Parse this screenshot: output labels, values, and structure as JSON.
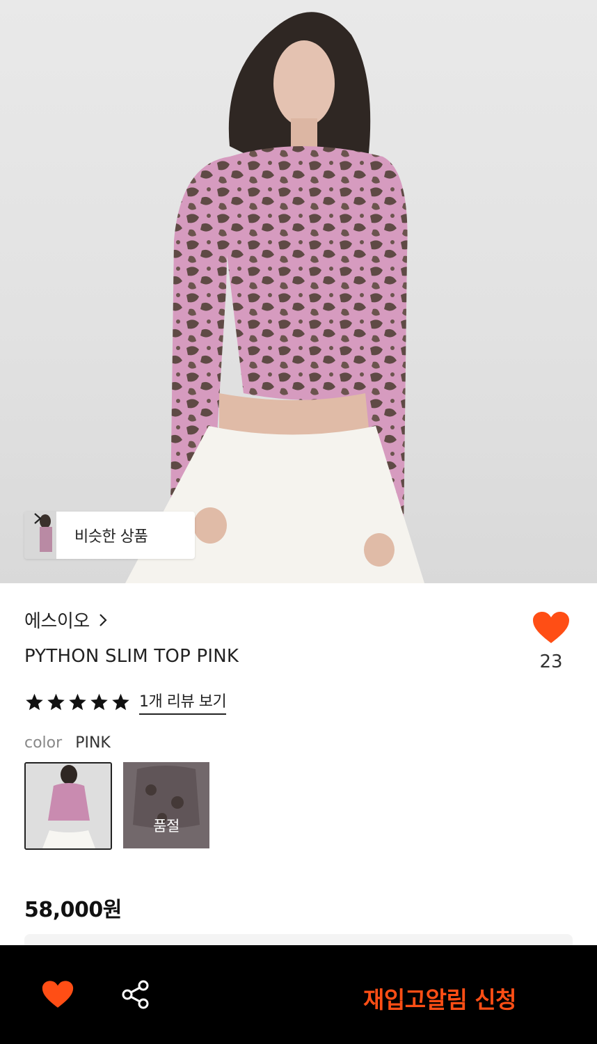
{
  "hero": {
    "similar_products_label": "비슷한 상품"
  },
  "product": {
    "brand": "에스이오",
    "title": "PYTHON SLIM TOP PINK",
    "like_count": "23",
    "rating_stars": 5,
    "review_link": "1개 리뷰 보기",
    "color_label": "color",
    "color_value": "PINK",
    "swatches": [
      {
        "name": "PINK",
        "selected": true,
        "sold_out": false
      },
      {
        "name": "",
        "selected": false,
        "sold_out": true,
        "sold_out_label": "품절"
      }
    ],
    "price": "58,000원"
  },
  "bottom_bar": {
    "restock_button": "재입고알림 신청"
  },
  "colors": {
    "accent": "#ff4e15",
    "bar_background": "#000000",
    "text_primary": "#222222"
  },
  "icons": [
    "chevron-right-icon",
    "heart-icon",
    "star-icon",
    "share-icon"
  ]
}
